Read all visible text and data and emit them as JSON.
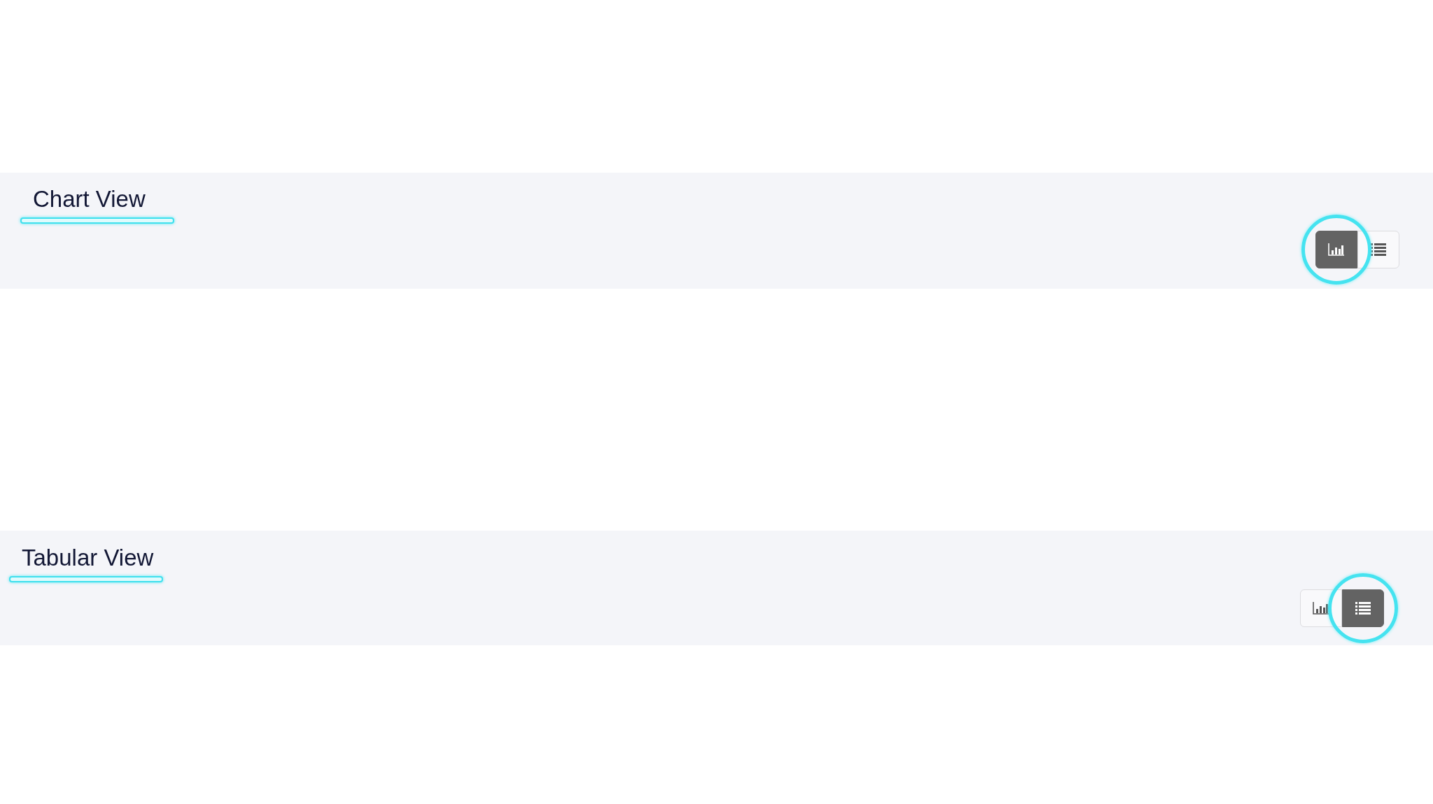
{
  "sections": [
    {
      "title": "Chart View",
      "title_highlighted": true,
      "buttons": [
        {
          "kind": "chart",
          "selected": true,
          "highlighted": true
        },
        {
          "kind": "list",
          "selected": false,
          "highlighted": false
        }
      ]
    },
    {
      "title": "Tabular View",
      "title_highlighted": true,
      "buttons": [
        {
          "kind": "chart",
          "selected": false,
          "highlighted": false
        },
        {
          "kind": "list",
          "selected": true,
          "highlighted": true
        }
      ]
    }
  ]
}
